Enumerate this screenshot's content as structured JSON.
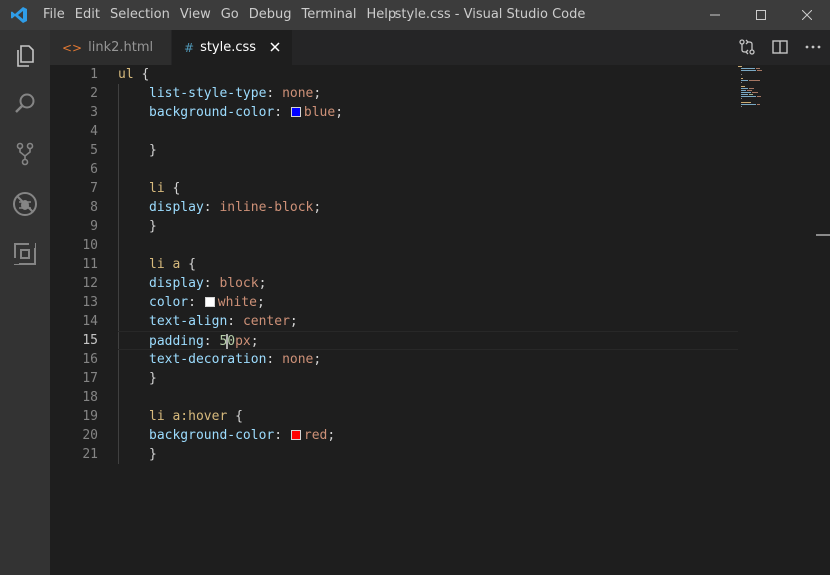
{
  "window": {
    "title": "style.css - Visual Studio Code",
    "menu": [
      "File",
      "Edit",
      "Selection",
      "View",
      "Go",
      "Debug",
      "Terminal",
      "Help"
    ]
  },
  "tabs": [
    {
      "label": "link2.html",
      "icon": "html-file-icon",
      "icon_glyph": "<>",
      "active": false
    },
    {
      "label": "style.css",
      "icon": "css-file-icon",
      "icon_glyph": "#",
      "active": true
    }
  ],
  "activity_bar": [
    "explorer-icon",
    "search-icon",
    "source-control-icon",
    "debug-icon",
    "extensions-icon"
  ],
  "editor": {
    "current_line": 15,
    "line_numbers": [
      "1",
      "2",
      "3",
      "4",
      "5",
      "6",
      "7",
      "8",
      "9",
      "10",
      "11",
      "12",
      "13",
      "14",
      "15",
      "16",
      "17",
      "18",
      "19",
      "20",
      "21"
    ],
    "lines": {
      "l1_sel": "ul",
      "l1_brace": " {",
      "l2_prop": "list-style-type",
      "l2_colon": ": ",
      "l2_val": "none",
      "l2_end": ";",
      "l3_prop": "background-color",
      "l3_colon": ": ",
      "l3_val": "blue",
      "l3_end": ";",
      "l5_brace": "}",
      "l7_sel": "li",
      "l7_brace": " {",
      "l8_prop": "display",
      "l8_colon": ": ",
      "l8_val": "inline-block",
      "l8_end": ";",
      "l9_brace": "}",
      "l11_sel": "li a",
      "l11_brace": " {",
      "l12_prop": "display",
      "l12_colon": ": ",
      "l12_val": "block",
      "l12_end": ";",
      "l13_prop": "color",
      "l13_colon": ": ",
      "l13_val": "white",
      "l13_end": ";",
      "l14_prop": "text-align",
      "l14_colon": ": ",
      "l14_val": "center",
      "l14_end": ";",
      "l15_prop": "padding",
      "l15_colon": ": ",
      "l15_num": "50",
      "l15_unit": "px",
      "l15_end": ";",
      "l16_prop": "text-decoration",
      "l16_colon": ": ",
      "l16_val": "none",
      "l16_end": ";",
      "l17_brace": "}",
      "l19_sel": "li a:hover",
      "l19_brace": " {",
      "l20_prop": "background-color",
      "l20_colon": ": ",
      "l20_val": "red",
      "l20_end": ";",
      "l21_brace": "}"
    },
    "swatches": {
      "blue": "#0000ff",
      "white": "#ffffff",
      "red": "#ff0000"
    }
  },
  "colors": {
    "accent": "#007acc",
    "titlebar": "#3c3c3c",
    "activity_bar": "#333333",
    "editor_bg": "#1e1e1e",
    "selector": "#d7ba7d",
    "property": "#9cdcfe",
    "value": "#ce9178",
    "number": "#b5cea8"
  }
}
